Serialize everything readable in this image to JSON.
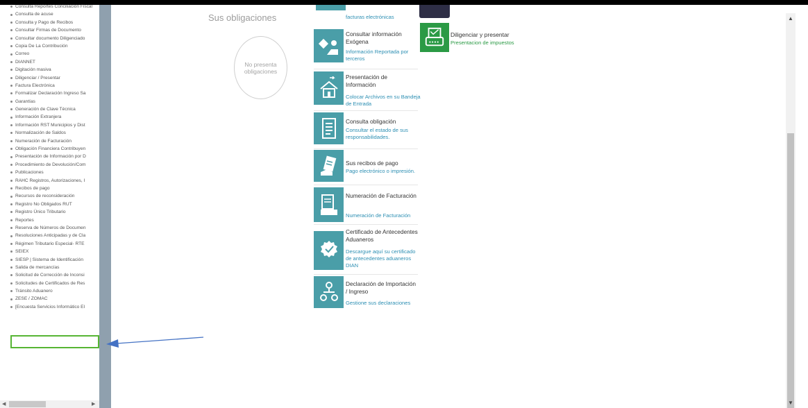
{
  "sidebar": {
    "items": [
      "Consulta Reportes Conciliación Fiscal",
      "Consulta de acuse",
      "Consulta y Pago de Recibos",
      "Consultar Firmas de Documento",
      "Consultar documento Diligenciado",
      "Copia De La Contribución",
      "Correo",
      "DIANNET",
      "Digitación masiva",
      "Diligenciar / Presentar",
      "Factura Electrónica",
      "Formalizar Declaración Ingreso Sa",
      "Garantías",
      "Generación de Clave Técnica",
      "Información Extranjera",
      "Información RST Municipios y Dist",
      "Normalización de Saldos",
      "Numeración de Facturación",
      "Obligación Financiera Contribuyen",
      "Presentación de Información por D",
      "Procedimiento de Devolución/Com",
      "Publicaciones",
      "RAHC Registros, Autorizaciones, I",
      "Recibos de pago",
      "Recursos de reconsideración",
      "Registro No Obligados RUT",
      "Registro Único Tributario",
      "Reportes",
      "Reserva de Números de Documen",
      "Resoluciones Anticipadas y de Cla",
      "Régimen Tributario Especial- RTE",
      "SEIEX",
      "SIESP | Sistema de Identificación",
      "Salida de mercancías",
      "Solicitud de Corrección de Inconsi",
      "Solicitudes de Certificados de Res",
      "Tránsito Aduanero",
      "ZESE / ZOMAC",
      "[Encuesta Servicios Informático El"
    ]
  },
  "obligaciones": {
    "title": "Sus obligaciones",
    "empty_text": "No presenta obligaciones"
  },
  "tiles": {
    "efact_sub": "facturas electrónicas",
    "exogena": {
      "title": "Consultar información Exógena",
      "sub": "Información Reportada por terceros"
    },
    "presentacion": {
      "title": "Presentación de Información",
      "sub": "Colocar Archivos en su Bandeja de Entrada"
    },
    "consulta_oblig": {
      "title": "Consulta obligación",
      "sub": "Consultar el estado de sus responsabilidades."
    },
    "recibos": {
      "title": "Sus recibos de pago",
      "sub": "Pago electrónico o impresión."
    },
    "numeracion": {
      "title": "Numeración de Facturación",
      "sub": "Numeración de Facturación"
    },
    "certificado": {
      "title": "Certificado de Antecedentes Aduaneros",
      "sub": "Descargue aquí su certificado de antecedentes aduaneros DIAN"
    },
    "declaracion": {
      "title": "Declaración de Importación / Ingreso",
      "sub": "Gestione sus declaraciones"
    },
    "diligenciar": {
      "title": "Diligenciar y presentar",
      "sub": "Presentacion de impuestos"
    }
  },
  "colors": {
    "tile_teal": "#4a9ea8",
    "tile_green": "#2b9a45",
    "link_blue": "#2d8fb3",
    "highlight_green": "#56b533",
    "arrow_blue": "#4472c4"
  },
  "icons": {
    "efact": "invoice-icon",
    "exogena": "hand-card-icon",
    "presentacion": "house-arrow-icon",
    "consulta_oblig": "document-list-icon",
    "recibos": "receipt-hand-icon",
    "numeracion": "calculator-doc-icon",
    "certificado": "certificate-badge-icon",
    "declaracion": "org-chart-icon",
    "diligenciar": "printer-form-icon"
  }
}
